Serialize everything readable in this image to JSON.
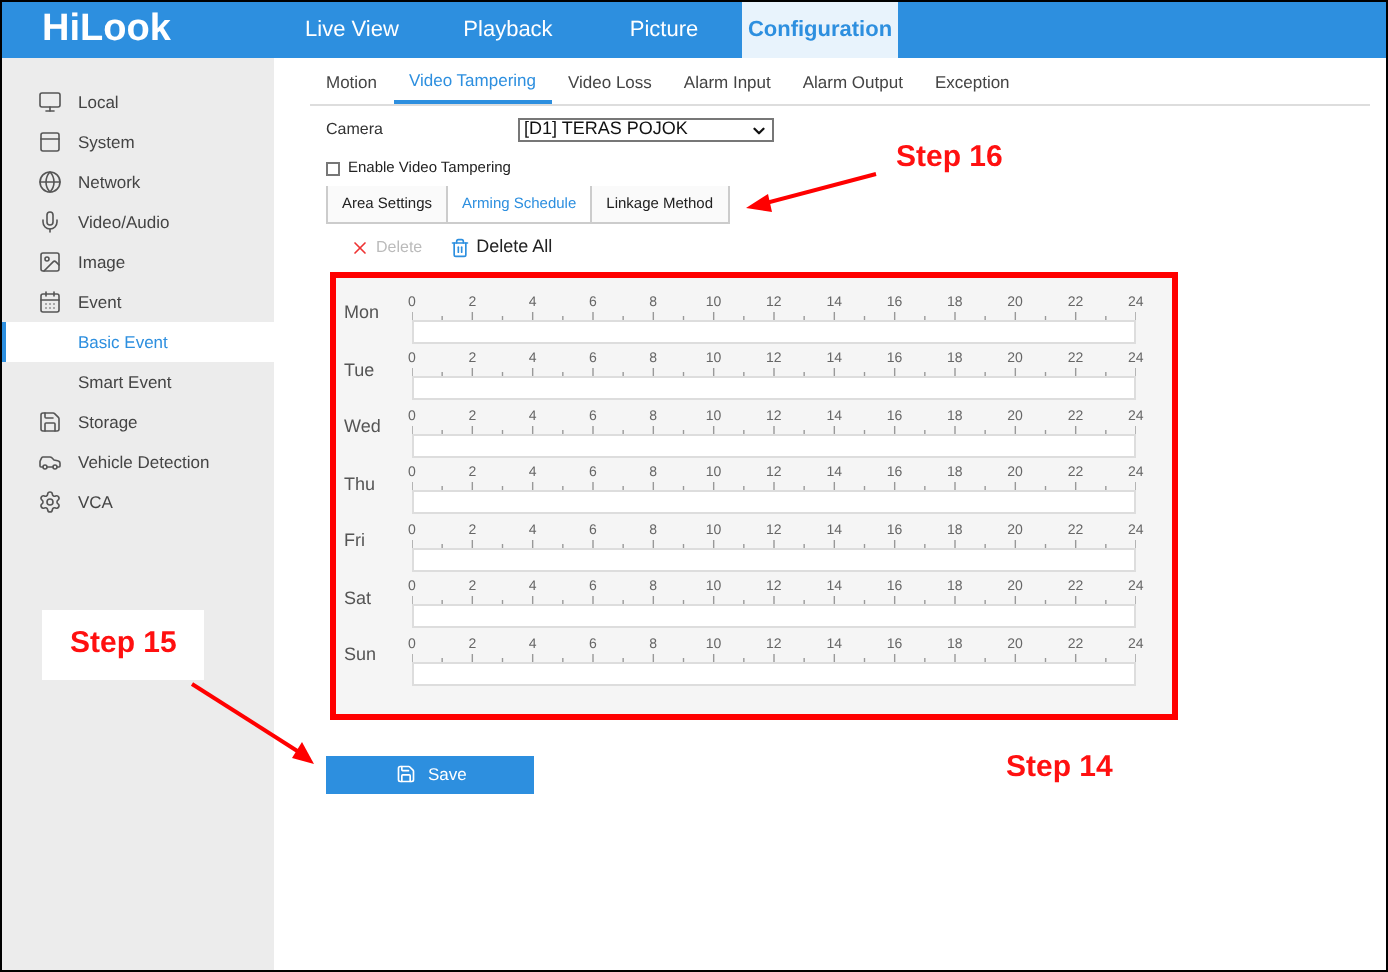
{
  "header": {
    "logo": "HiLook",
    "nav": [
      {
        "label": "Live View",
        "selected": false
      },
      {
        "label": "Playback",
        "selected": false
      },
      {
        "label": "Picture",
        "selected": false
      },
      {
        "label": "Configuration",
        "selected": true
      }
    ]
  },
  "sidebar": {
    "items": [
      {
        "label": "Local",
        "kind": "main",
        "selected": false
      },
      {
        "label": "System",
        "kind": "main",
        "selected": false
      },
      {
        "label": "Network",
        "kind": "main",
        "selected": false
      },
      {
        "label": "Video/Audio",
        "kind": "main",
        "selected": false
      },
      {
        "label": "Image",
        "kind": "main",
        "selected": false
      },
      {
        "label": "Event",
        "kind": "main",
        "selected": false
      },
      {
        "label": "Basic Event",
        "kind": "sub",
        "selected": true
      },
      {
        "label": "Smart Event",
        "kind": "sub",
        "selected": false
      },
      {
        "label": "Storage",
        "kind": "main",
        "selected": false
      },
      {
        "label": "Vehicle Detection",
        "kind": "main",
        "selected": false
      },
      {
        "label": "VCA",
        "kind": "main",
        "selected": false
      }
    ]
  },
  "tabs": [
    {
      "label": "Motion",
      "selected": false
    },
    {
      "label": "Video Tampering",
      "selected": true
    },
    {
      "label": "Video Loss",
      "selected": false
    },
    {
      "label": "Alarm Input",
      "selected": false
    },
    {
      "label": "Alarm Output",
      "selected": false
    },
    {
      "label": "Exception",
      "selected": false
    }
  ],
  "camera": {
    "label": "Camera",
    "value": "[D1] TERAS POJOK"
  },
  "enable": {
    "label": "Enable Video Tampering",
    "checked": false
  },
  "steps": [
    {
      "label": "Area Settings",
      "selected": false
    },
    {
      "label": "Arming Schedule",
      "selected": true
    },
    {
      "label": "Linkage Method",
      "selected": false
    }
  ],
  "toolbar": {
    "delete": {
      "label": "Delete",
      "disabled": true
    },
    "delete_all": {
      "label": "Delete All",
      "disabled": false
    }
  },
  "schedule": {
    "days": [
      {
        "label": "Mon",
        "hours": [
          "0",
          "2",
          "4",
          "6",
          "8",
          "10",
          "12",
          "14",
          "16",
          "18",
          "20",
          "22",
          "24"
        ]
      },
      {
        "label": "Tue",
        "hours": [
          "0",
          "2",
          "4",
          "6",
          "8",
          "10",
          "12",
          "14",
          "16",
          "18",
          "20",
          "22",
          "24"
        ]
      },
      {
        "label": "Wed",
        "hours": [
          "0",
          "2",
          "4",
          "6",
          "8",
          "10",
          "12",
          "14",
          "16",
          "18",
          "20",
          "22",
          "24"
        ]
      },
      {
        "label": "Thu",
        "hours": [
          "0",
          "2",
          "4",
          "6",
          "8",
          "10",
          "12",
          "14",
          "16",
          "18",
          "20",
          "22",
          "24"
        ]
      },
      {
        "label": "Fri",
        "hours": [
          "0",
          "2",
          "4",
          "6",
          "8",
          "10",
          "12",
          "14",
          "16",
          "18",
          "20",
          "22",
          "24"
        ]
      },
      {
        "label": "Sat",
        "hours": [
          "0",
          "2",
          "4",
          "6",
          "8",
          "10",
          "12",
          "14",
          "16",
          "18",
          "20",
          "22",
          "24"
        ]
      },
      {
        "label": "Sun",
        "hours": [
          "0",
          "2",
          "4",
          "6",
          "8",
          "10",
          "12",
          "14",
          "16",
          "18",
          "20",
          "22",
          "24"
        ]
      }
    ]
  },
  "save": {
    "label": "Save"
  },
  "annotations": [
    {
      "label": "Step 16",
      "kind": "plain"
    },
    {
      "label": "Step 15",
      "kind": "boxed"
    },
    {
      "label": "Step 14",
      "kind": "plain"
    }
  ]
}
